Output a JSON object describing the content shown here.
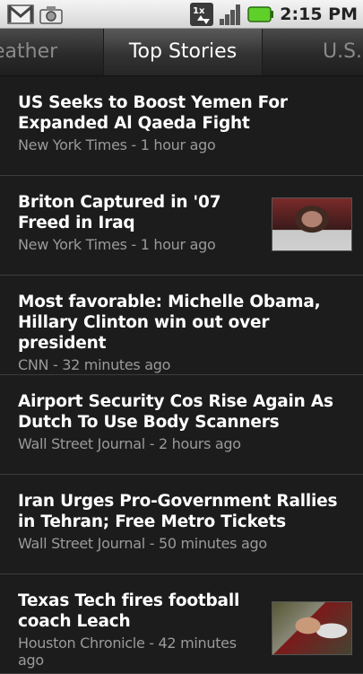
{
  "status_bar": {
    "time": "2:15 PM",
    "icons": [
      "gmail-icon",
      "camera-icon",
      "data-transfer-icon",
      "signal-icon",
      "battery-icon"
    ]
  },
  "tabs": [
    {
      "label": "Weather",
      "display": "eather",
      "active": false
    },
    {
      "label": "Top Stories",
      "display": "Top Stories",
      "active": true
    },
    {
      "label": "U.S.",
      "display": "U.S.",
      "active": false
    }
  ],
  "stories": [
    {
      "title": "US Seeks to Boost Yemen For Expanded Al Qaeda Fight",
      "source": "New York Times",
      "time": "1 hour ago",
      "meta": "New York Times - 1 hour ago",
      "thumbnail": false
    },
    {
      "title": "Briton Captured in '07 Freed in Iraq",
      "source": "New York Times",
      "time": "1 hour ago",
      "meta": "New York Times - 1 hour ago",
      "thumbnail": true
    },
    {
      "title": "Most favorable: Michelle Obama, Hillary Clinton win out over president",
      "source": "CNN",
      "time": "32 minutes ago",
      "meta": "CNN - 32 minutes ago",
      "thumbnail": false
    },
    {
      "title": "Airport Security Cos Rise Again As Dutch To Use Body Scanners",
      "source": "Wall Street Journal",
      "time": "2 hours ago",
      "meta": "Wall Street Journal - 2 hours ago",
      "thumbnail": false
    },
    {
      "title": "Iran Urges Pro-Government Rallies in Tehran; Free Metro Tickets",
      "source": "Wall Street Journal",
      "time": "50 minutes ago",
      "meta": "Wall Street Journal - 50 minutes ago",
      "thumbnail": false
    },
    {
      "title": "Texas Tech fires football coach Leach",
      "source": "Houston Chronicle",
      "time": "42 minutes ago",
      "meta": "Houston Chronicle - 42 minutes ago",
      "thumbnail": true
    }
  ],
  "colors": {
    "accent_battery": "#5fcf2a",
    "background": "#1c1c1c",
    "meta_text": "#9a9a9a"
  }
}
